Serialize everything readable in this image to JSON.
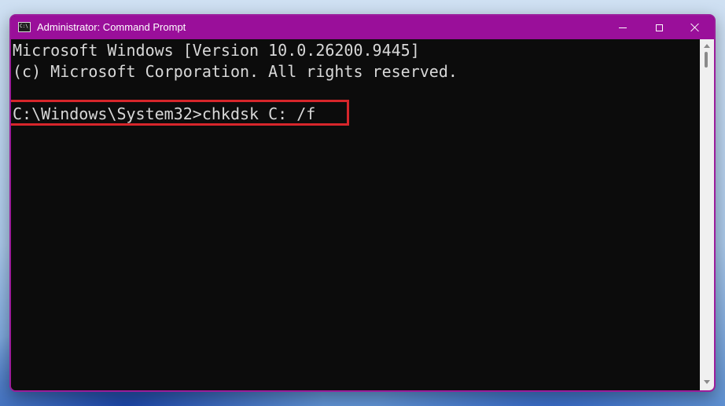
{
  "window": {
    "title": "Administrator: Command Prompt",
    "icon": "cmd-icon",
    "icon_glyph": "C:\\",
    "controls": {
      "minimize": "minimize-icon",
      "maximize": "maximize-icon",
      "close": "close-icon"
    },
    "accent_color": "#9a0f9a"
  },
  "console": {
    "lines": [
      "Microsoft Windows [Version 10.0.26200.9445]",
      "(c) Microsoft Corporation. All rights reserved.",
      "C:\\Windows\\System32>chkdsk C: /f"
    ],
    "background_color": "#0c0c0c",
    "text_color": "#d8d8d8",
    "highlight_color": "#d7262b"
  }
}
